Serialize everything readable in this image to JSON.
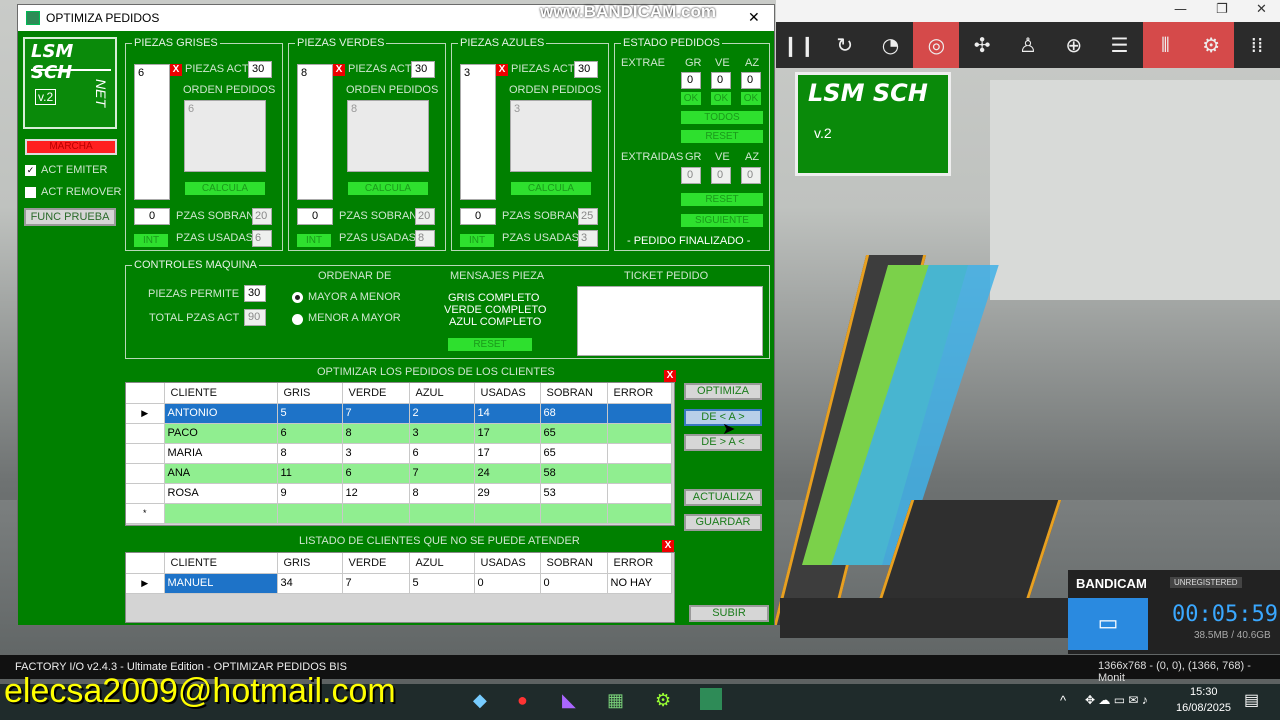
{
  "watermark": "www.BANDICAM.com",
  "window": {
    "title": "OPTIMIZA PEDIDOS",
    "close": "✕"
  },
  "logo": {
    "line1": "LSM SCH",
    "v": "v.2",
    "net": "NET"
  },
  "left": {
    "marcha": "MARCHA",
    "act_emiter": "ACT EMITER",
    "act_remover": "ACT REMOVER",
    "func_prueba": "FUNC PRUEBA"
  },
  "grises": {
    "title": "PIEZAS GRISES",
    "list_val": "6",
    "x": "X",
    "piezas_act_label": "PIEZAS ACT",
    "piezas_act": "30",
    "orden_label": "ORDEN PEDIDOS",
    "orden_val": "6",
    "calcula": "CALCULA",
    "sobran_in": "0",
    "sobran_label": "PZAS SOBRAN",
    "sobran": "20",
    "int": "INT",
    "usadas_label": "PZAS USADAS",
    "usadas": "6"
  },
  "verdes": {
    "title": "PIEZAS VERDES",
    "list_val": "8",
    "x": "X",
    "piezas_act_label": "PIEZAS ACT",
    "piezas_act": "30",
    "orden_label": "ORDEN PEDIDOS",
    "orden_val": "8",
    "calcula": "CALCULA",
    "sobran_in": "0",
    "sobran_label": "PZAS SOBRAN",
    "sobran": "20",
    "int": "INT",
    "usadas_label": "PZAS USADAS",
    "usadas": "8"
  },
  "azules": {
    "title": "PIEZAS AZULES",
    "list_val": "3",
    "x": "X",
    "piezas_act_label": "PIEZAS ACT",
    "piezas_act": "30",
    "orden_label": "ORDEN PEDIDOS",
    "orden_val": "3",
    "calcula": "CALCULA",
    "sobran_in": "0",
    "sobran_label": "PZAS SOBRAN",
    "sobran": "25",
    "int": "INT",
    "usadas_label": "PZAS USADAS",
    "usadas": "3"
  },
  "estado": {
    "title": "ESTADO PEDIDOS",
    "extrae": "EXTRAE",
    "gr": "GR",
    "ve": "VE",
    "az": "AZ",
    "ex_gr": "0",
    "ex_ve": "0",
    "ex_az": "0",
    "ok": "OK",
    "todos": "TODOS",
    "reset": "RESET",
    "extraidas": "EXTRAIDAS",
    "ed_gr": "0",
    "ed_ve": "0",
    "ed_az": "0",
    "reset2": "RESET",
    "siguiente": "SIGUIENTE",
    "finalizado": "-   PEDIDO FINALIZADO   -"
  },
  "controles": {
    "title": "CONTROLES MAQUINA",
    "piezas_permite": "PIEZAS PERMITE",
    "piezas_permite_val": "30",
    "total_label": "TOTAL PZAS ACT",
    "total_val": "90",
    "ordenar": "ORDENAR DE",
    "mayor": "MAYOR A MENOR",
    "menor": "MENOR A MAYOR",
    "mensajes": "MENSAJES PIEZA",
    "msg1": "GRIS COMPLETO",
    "msg2": "VERDE COMPLETO",
    "msg3": "AZUL COMPLETO",
    "reset": "RESET",
    "ticket": "TICKET PEDIDO"
  },
  "optimizar": {
    "title": "OPTIMIZAR LOS PEDIDOS DE LOS CLIENTES",
    "headers": [
      "CLIENTE",
      "GRIS",
      "VERDE",
      "AZUL",
      "USADAS",
      "SOBRAN",
      "ERROR"
    ],
    "rows": [
      [
        "ANTONIO",
        "5",
        "7",
        "2",
        "14",
        "68",
        ""
      ],
      [
        "PACO",
        "6",
        "8",
        "3",
        "17",
        "65",
        ""
      ],
      [
        "MARIA",
        "8",
        "3",
        "6",
        "17",
        "65",
        ""
      ],
      [
        "ANA",
        "11",
        "6",
        "7",
        "24",
        "58",
        ""
      ],
      [
        "ROSA",
        "9",
        "12",
        "8",
        "29",
        "53",
        ""
      ]
    ],
    "new_row_marker": "*"
  },
  "side_buttons": {
    "optimiza": "OPTIMIZA",
    "de_a_gt": "DE < A >",
    "de_gt_a": "DE > A <",
    "actualiza": "ACTUALIZA",
    "guardar": "GUARDAR",
    "subir": "SUBIR"
  },
  "no_atender": {
    "title": "LISTADO DE CLIENTES QUE NO SE PUEDE ATENDER",
    "headers": [
      "CLIENTE",
      "GRIS",
      "VERDE",
      "AZUL",
      "USADAS",
      "SOBRAN",
      "ERROR"
    ],
    "rows": [
      [
        "MANUEL",
        "34",
        "7",
        "5",
        "0",
        "0",
        "NO HAY"
      ]
    ]
  },
  "scene": {
    "sign_line1": "LSM SCH",
    "sign_v": "v.2"
  },
  "factory_status": "FACTORY I/O v2.4.3 - Ultimate Edition - OPTIMIZAR PEDIDOS BIS",
  "bandicam": {
    "brand": "BANDICAM",
    "unreg": "UNREGISTERED",
    "timer": "00:05:59",
    "size": "38.5MB / 40.6GB",
    "region": "1366x768 - (0, 0), (1366, 768) - Monit"
  },
  "email": "elecsa2009@hotmail.com",
  "clock": {
    "time": "15:30",
    "date": "16/08/2025"
  }
}
